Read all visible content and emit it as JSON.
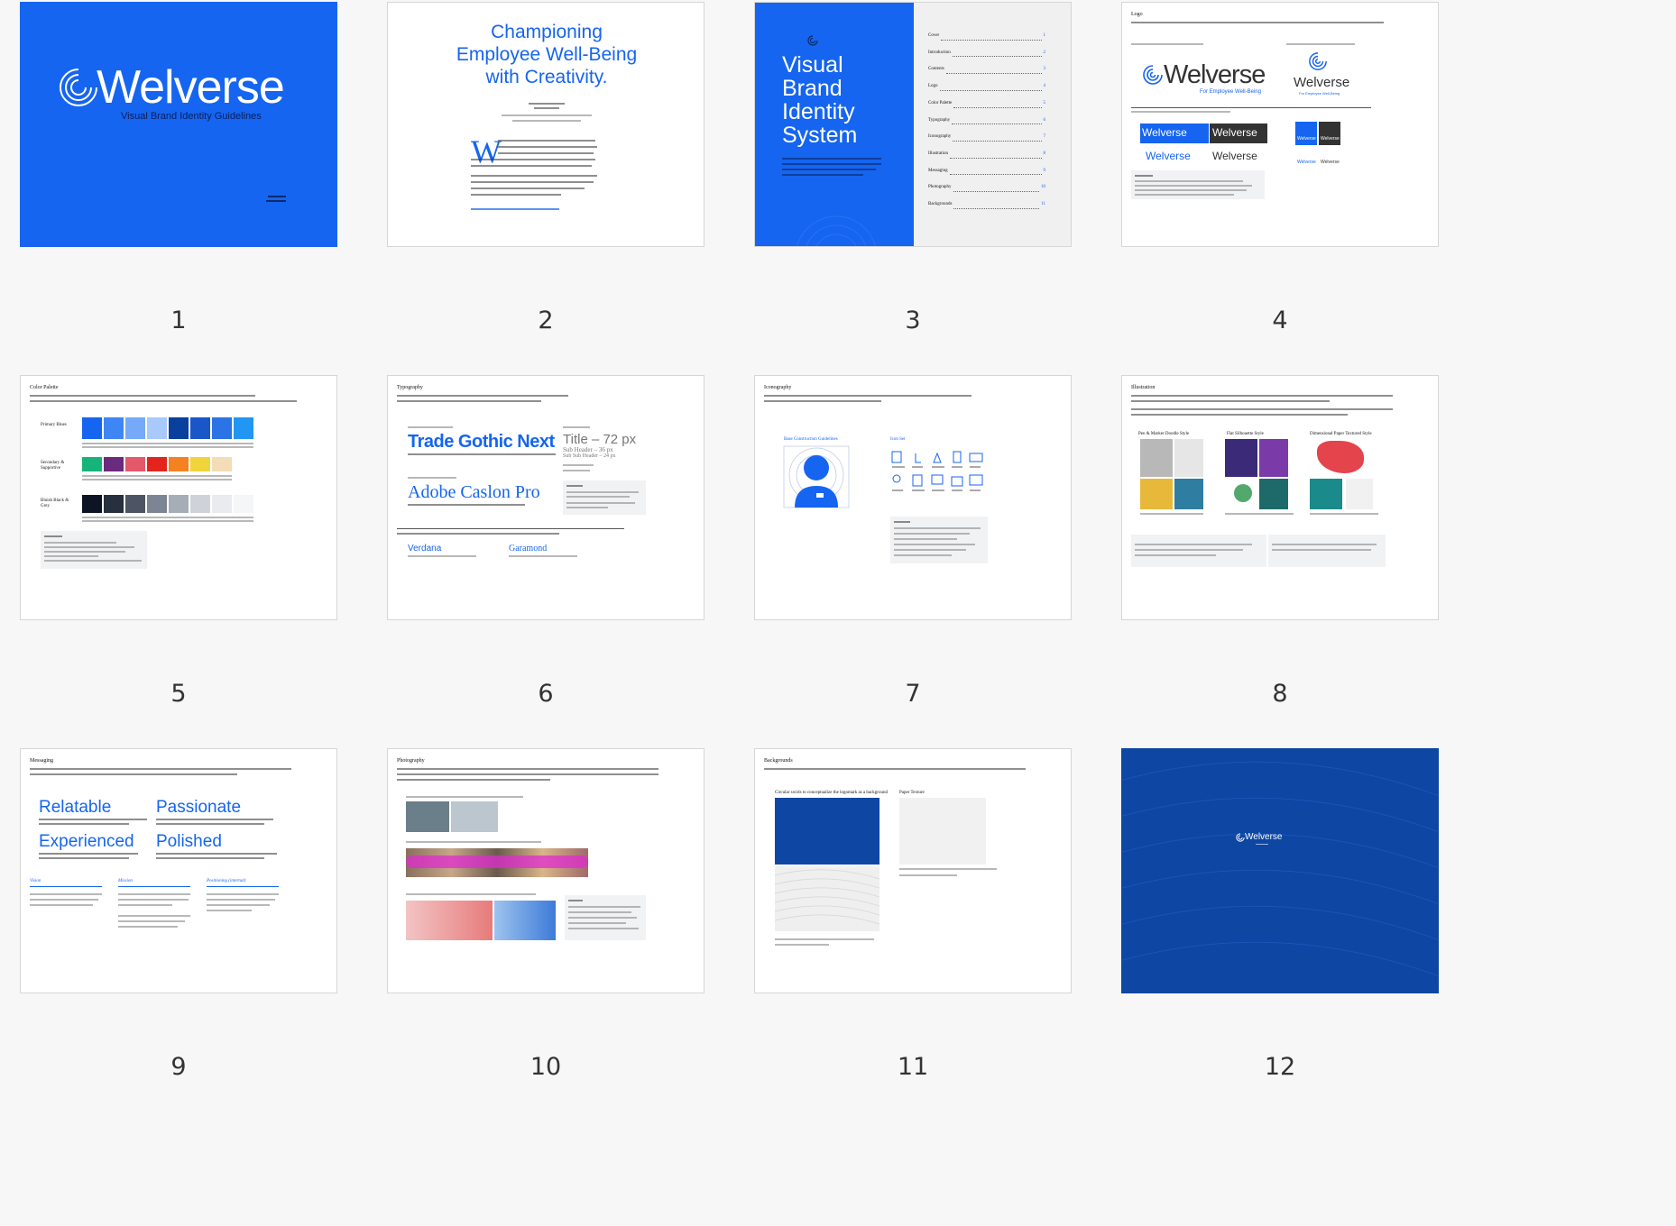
{
  "slides": [
    {
      "n": "1",
      "brand": "Welverse",
      "subtitle": "Visual Brand Identity Guidelines"
    },
    {
      "n": "2",
      "title_lines": [
        "Championing",
        "Employee Well-Being",
        "with Creativity."
      ],
      "dropcap": "W"
    },
    {
      "n": "3",
      "title_lines": [
        "Visual",
        "Brand",
        "Identity",
        "System"
      ],
      "toc": [
        [
          "Cover",
          "1"
        ],
        [
          "Introduction",
          "2"
        ],
        [
          "Contents",
          "3"
        ],
        [
          "Logo",
          "4"
        ],
        [
          "Color Palette",
          "5"
        ],
        [
          "Typography",
          "6"
        ],
        [
          "Iconography",
          "7"
        ],
        [
          "Illustration",
          "8"
        ],
        [
          "Messaging",
          "9"
        ],
        [
          "Photography",
          "10"
        ],
        [
          "Backgrounds",
          "11"
        ]
      ]
    },
    {
      "n": "4",
      "heading": "Logo",
      "brand": "Welverse",
      "tag": "For Employee Well-Being"
    },
    {
      "n": "5",
      "heading": "Color Palette",
      "groups": [
        "Primary Blues",
        "Secondary & Supportive",
        "Bluish Black & Grey"
      ],
      "primary": [
        "#1565f0",
        "#3f86f5",
        "#76a9f7",
        "#a9c9fb",
        "#0b3f9e",
        "#1a56c8",
        "#2c73e6",
        "#2196f3"
      ],
      "secondary": [
        "#16b37a",
        "#6a2a7e",
        "#e3586b",
        "#e3241c",
        "#f58220",
        "#f1d33b",
        "#f3dcb6"
      ],
      "greys": [
        "#0d1524",
        "#27303f",
        "#4d5565",
        "#7d8594",
        "#a7adb7",
        "#cfd3d9",
        "#e9ebee",
        "#f5f6f7"
      ]
    },
    {
      "n": "6",
      "heading": "Typography",
      "font1": "Trade Gothic Next",
      "font2": "Adobe Caslon Pro",
      "size_title": "Title – 72 px",
      "size_sub": "Sub Header – 36 px",
      "size_subsub": "Sub Sub Header – 24 px",
      "font3": "Verdana",
      "font4": "Garamond"
    },
    {
      "n": "7",
      "heading": "Iconography",
      "left_label": "Base Construction Guidelines",
      "right_label": "Icon Set"
    },
    {
      "n": "8",
      "heading": "Illustration",
      "cols": [
        "Pen & Marker Doodle Style",
        "Flat Silhouette Style",
        "Dimensional Paper Textured Style"
      ]
    },
    {
      "n": "9",
      "heading": "Messaging",
      "words": [
        "Relatable",
        "Passionate",
        "Experienced",
        "Polished"
      ],
      "sub": [
        "Vision",
        "Mission",
        "Positioning (internal)"
      ]
    },
    {
      "n": "10",
      "heading": "Photography"
    },
    {
      "n": "11",
      "heading": "Backgrounds",
      "labels": [
        "Circular swirls to conceptualize the logomark as a background",
        "Paper Texture"
      ]
    },
    {
      "n": "12",
      "brand": "Welverse"
    }
  ]
}
